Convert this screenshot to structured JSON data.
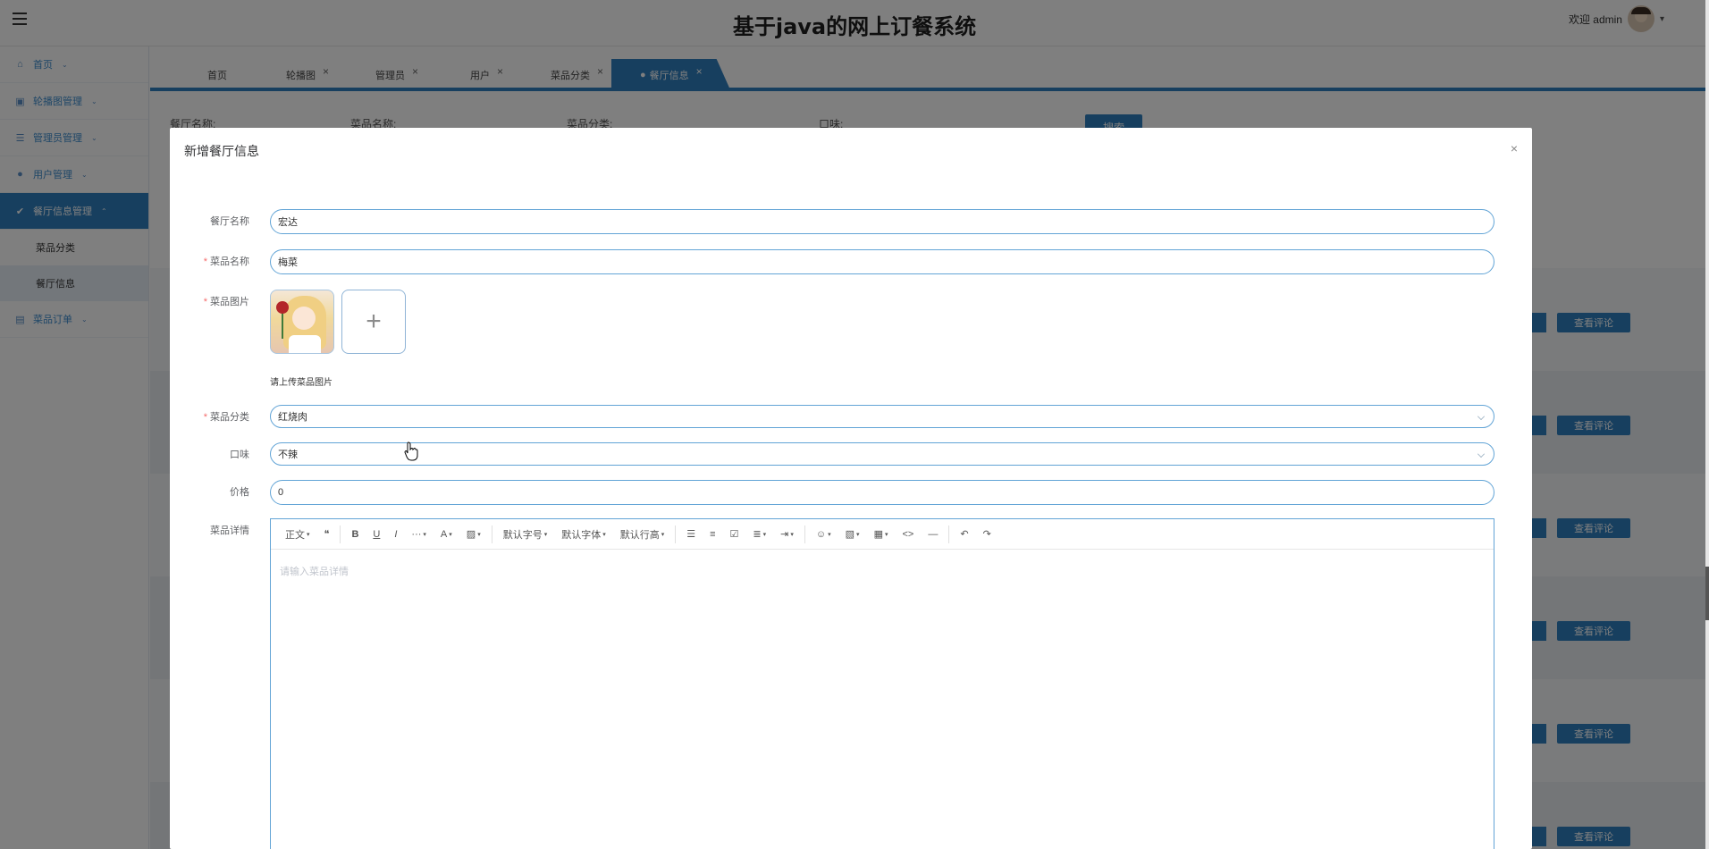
{
  "header": {
    "title": "基于java的网上订餐系统",
    "welcome": "欢迎 admin"
  },
  "sidebar": {
    "items": [
      {
        "label": "首页"
      },
      {
        "label": "轮播图管理"
      },
      {
        "label": "管理员管理"
      },
      {
        "label": "用户管理"
      },
      {
        "label": "餐厅信息管理"
      },
      {
        "label": "菜品订单"
      }
    ],
    "sub_items": [
      "菜品分类",
      "餐厅信息"
    ]
  },
  "tabs": [
    {
      "label": "首页"
    },
    {
      "label": "轮播图"
    },
    {
      "label": "管理员"
    },
    {
      "label": "用户"
    },
    {
      "label": "菜品分类"
    },
    {
      "label": "餐厅信息"
    }
  ],
  "background": {
    "filters": [
      "餐厅名称:",
      "菜品名称:",
      "菜品分类:",
      "口味:"
    ],
    "search_label": "搜索",
    "review_label": "查看评论"
  },
  "dialog": {
    "title": "新增餐厅信息",
    "close": "×",
    "fields": {
      "restaurant": {
        "label": "餐厅名称",
        "value": "宏达"
      },
      "dish_name": {
        "label": "菜品名称",
        "value": "梅菜"
      },
      "dish_image": {
        "label": "菜品图片",
        "tip": "请上传菜品图片"
      },
      "category": {
        "label": "菜品分类",
        "value": "红烧肉"
      },
      "flavor": {
        "label": "口味",
        "value": "不辣"
      },
      "price": {
        "label": "价格",
        "value": "0"
      },
      "detail": {
        "label": "菜品详情",
        "placeholder": "请输入菜品详情"
      }
    },
    "toolbar": {
      "paragraph": "正文",
      "font_size": "默认字号",
      "font_family": "默认字体",
      "line_height": "默认行高"
    }
  },
  "colors": {
    "primary": "#2f7fbf",
    "input_border": "#62a4d6",
    "required": "#f56c6c"
  }
}
